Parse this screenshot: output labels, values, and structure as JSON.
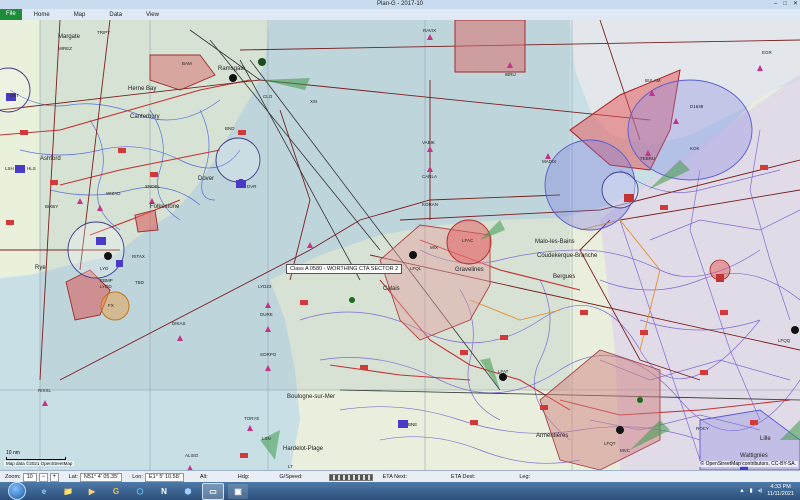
{
  "window": {
    "title": "Plan-G - 2017-10",
    "controls": [
      "–",
      "□",
      "✕"
    ]
  },
  "ribbon": {
    "file": "File",
    "tabs": [
      "Home",
      "Map",
      "Data",
      "View"
    ]
  },
  "map": {
    "tooltip": "Class A 0580 - WORTHING CTA SECTOR 2",
    "scale_label": "10 nm",
    "attribution": "© OpenStreetMap contributors, CC-BY-SA.",
    "attribution_left": "Map data ©2021 OpenStreetMap",
    "towns": {
      "boulogne": "Boulogne-sur-Mer",
      "calais": "Calais",
      "gravelines": "Gravelines",
      "bergues": "Bergues",
      "coudekerque": "Coudekerque-Branche",
      "malo": "Malo-les-Bains",
      "rye": "Rye",
      "hardelot": "Hardelot-Plage",
      "lille": "Lille",
      "armentieres": "Armentières",
      "wattignies": "Wattignies",
      "ramsgate": "Ramsgate",
      "herne": "Herne Bay",
      "canterbury": "Canterbury",
      "folkestone": "Folkestone",
      "dover": "Dover",
      "ashford": "Ashford",
      "margate": "Margate"
    },
    "waypoints": {
      "ravix": "RAVIX",
      "ibru": "IBRU",
      "vabik": "VABIK",
      "carla": "CARLA",
      "koran": "KORAN",
      "madix": "MADIX",
      "tebru": "TEBRU",
      "lydd": "LYD",
      "bnd": "BND",
      "dvr": "DVR",
      "det": "DET",
      "hls": "HLS",
      "lsh": "LSH",
      "bixby": "BIXBY",
      "wizad": "WIZAD",
      "sndel": "SNDEL",
      "ritax": "RITAX",
      "dikas": "DIKAS",
      "sorpo": "SORPO",
      "lyd23": "LYD23",
      "dure": "DURE",
      "rixxl": "RIXXL",
      "aliso": "ALISO",
      "lydd_rwy": "LYDD",
      "lfql": "LFQL",
      "lfac": "LFAC",
      "lfat": "LFAT",
      "lfqt": "LFQT",
      "lfqq": "LFQQ",
      "bne": "BNE",
      "mvc": "MVC",
      "cmb": "CMB",
      "kok": "KOK",
      "lsn": "LSN",
      "ltp": "LT",
      "torre": "TORYE",
      "mmx": "MIX",
      "fx": "FX",
      "rocy": "ROCY",
      "bulam": "BULAM",
      "d1638": "D1638",
      "egr": "EGR",
      "xsi": "XSI",
      "bam": "BAM",
      "mirez": "MIREZ",
      "tripy": "TRIPY",
      "clo": "CLO",
      "ebmp": "EBMP",
      "tbd": "TBD"
    }
  },
  "statusbar": {
    "zoom_label": "Zoom:",
    "zoom_value": "10",
    "lat_label": "Lat:",
    "lat_value": "N51° 4' 05.35'",
    "lon_label": "Lon:",
    "lon_value": "E1° 5' 10.58'",
    "alt_label": "Alt:",
    "hdg_label": "Hdg:",
    "gspeed_label": "G/Speed:",
    "eta_next_label": "ETA Next:",
    "eta_dest_label": "ETA Dest:",
    "leg_label": "Leg:"
  },
  "taskbar": {
    "apps": [
      "e",
      "📁",
      "▶",
      "G",
      "⬡",
      "N",
      "⬢",
      "▭",
      "▣"
    ],
    "time": "4:33 PM",
    "date": "11/11/2021"
  }
}
